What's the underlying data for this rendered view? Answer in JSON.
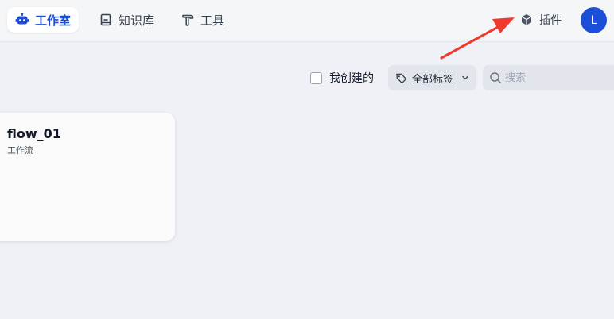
{
  "nav": {
    "items": [
      {
        "label": "工作室",
        "icon": "robot-icon",
        "active": true
      },
      {
        "label": "知识库",
        "icon": "book-icon",
        "active": false
      },
      {
        "label": "工具",
        "icon": "hammer-icon",
        "active": false
      }
    ],
    "plugins": {
      "label": "插件",
      "icon": "cube-icon"
    },
    "avatar": {
      "initial": "L"
    }
  },
  "filters": {
    "mine_label": "我创建的",
    "mine_checked": false,
    "tags_label": "全部标签",
    "search_placeholder": "搜索",
    "search_value": ""
  },
  "cards": [
    {
      "title": "flow_01",
      "type": "工作流"
    }
  ],
  "colors": {
    "accent": "#1d4ed8",
    "background": "#eff1f6",
    "annotation_arrow": "#f03a2e"
  }
}
